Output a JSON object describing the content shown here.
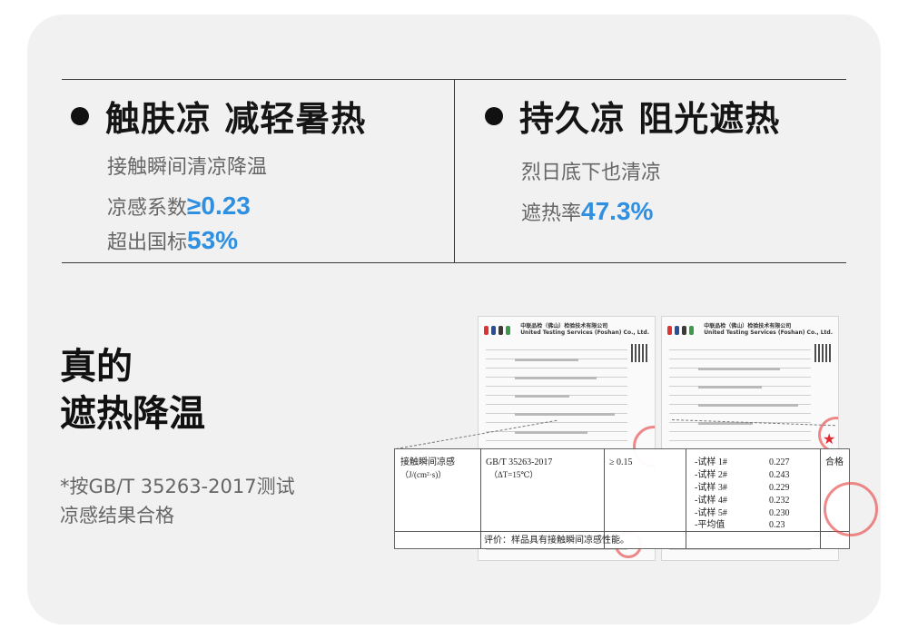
{
  "features": [
    {
      "title": "触肤凉 减轻暑热",
      "lines": [
        {
          "text": "接触瞬间清凉降温",
          "accent": ""
        },
        {
          "text": "凉感系数",
          "accent": "≥0.23"
        },
        {
          "text": "超出国标",
          "accent": "53%"
        }
      ]
    },
    {
      "title": "持久凉 阻光遮热",
      "lines": [
        {
          "text": "烈日底下也清凉",
          "accent": ""
        },
        {
          "text": "遮热率",
          "accent": "47.3%"
        }
      ]
    }
  ],
  "headline": [
    "真的",
    "遮热降温"
  ],
  "note": [
    "*按GB/T 35263-2017测试",
    "凉感结果合格"
  ],
  "report": {
    "org_name_cn": "中联品检（佛山）检验技术有限公司",
    "org_name_en": "United Testing Services (Foshan) Co., Ltd.",
    "zoom": {
      "item": "接触瞬间凉感",
      "unit": "（J/(cm²·s)）",
      "standard": "GB/T 35263-2017",
      "condition": "（ΔT=15℃）",
      "requirement": "≥ 0.15",
      "samples": [
        {
          "label": "-试样 1#",
          "value": "0.227"
        },
        {
          "label": "-试样 2#",
          "value": "0.243"
        },
        {
          "label": "-试样 3#",
          "value": "0.229"
        },
        {
          "label": "-试样 4#",
          "value": "0.232"
        },
        {
          "label": "-试样 5#",
          "value": "0.230"
        },
        {
          "label": "-平均值",
          "value": "0.23"
        }
      ],
      "verdict": "合格",
      "evaluation": "评价：样品具有接触瞬间凉感性能。"
    }
  },
  "colors": {
    "accent": "#2f8fe0",
    "card": "#f1f1f1",
    "stamp": "#e84a4a"
  }
}
